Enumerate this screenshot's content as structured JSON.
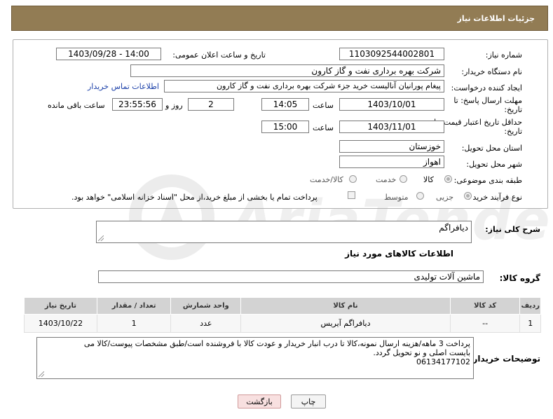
{
  "header": {
    "title": "جزئیات اطلاعات نیاز"
  },
  "form": {
    "need_number_label": "شماره نیاز:",
    "need_number": "1103092544002801",
    "announce_label": "تاریخ و ساعت اعلان عمومی:",
    "announce_value": "1403/09/28 - 14:00",
    "buyer_org_label": "نام دستگاه خریدار:",
    "buyer_org": "شرکت بهره برداری نفت و گاز کارون",
    "creator_label": "ایجاد کننده درخواست:",
    "creator": "پیغام پورانیان آنالیست خرید جزء شرکت بهره برداری نفت و گاز کارون",
    "contact_link": "اطلاعات تماس خریدار",
    "reply_deadline_label": "مهلت ارسال پاسخ: تا تاریخ:",
    "reply_date": "1403/10/01",
    "time_label": "ساعت",
    "reply_time": "14:05",
    "days_value": "2",
    "days_label": "روز و",
    "remaining_time": "23:55:56",
    "remaining_label": "ساعت باقی مانده",
    "price_validity_label": "حداقل تاریخ اعتبار قیمت: تا تاریخ:",
    "price_date": "1403/11/01",
    "price_time": "15:00",
    "province_label": "استان محل تحویل:",
    "province": "خوزستان",
    "city_label": "شهر محل تحویل:",
    "city": "اهواز",
    "category_label": "طبقه بندی موضوعی:",
    "category_options": [
      "کالا",
      "خدمت",
      "کالا/خدمت"
    ],
    "process_label": "نوع فرآیند خرید :",
    "process_options": [
      "جزیی",
      "متوسط"
    ],
    "payment_note": "پرداخت تمام یا بخشی از مبلغ خرید،از محل \"اسناد خزانه اسلامی\" خواهد بود."
  },
  "description": {
    "label": "شرح کلی نیاز:",
    "value": "دیافراگم"
  },
  "goods": {
    "section_title": "اطلاعات کالاهای مورد نیاز",
    "group_label": "گروه کالا:",
    "group_value": "ماشین آلات تولیدی",
    "columns": [
      "ردیف",
      "کد کالا",
      "نام کالا",
      "واحد شمارش",
      "تعداد / مقدار",
      "تاریخ نیاز"
    ],
    "rows": [
      {
        "index": "1",
        "code": "--",
        "name": "دیافراگم آیریس",
        "unit": "عدد",
        "qty": "1",
        "date": "1403/10/22"
      }
    ]
  },
  "buyer_notes": {
    "label": "توضیحات خریدار:",
    "line1": "پرداخت 3 ماهه/هزینه ارسال نمونه،کالا تا درب انبار خریدار و عودت کالا با فروشنده است/طبق مشخصات پیوست/کالا می",
    "line2": "بایست اصلی و نو تحویل گردد.",
    "line3": "06134177102"
  },
  "buttons": {
    "print": "چاپ",
    "back": "بازگشت"
  },
  "colors": {
    "header_bg": "#927c54",
    "link": "#1a3fa8",
    "table_header": "#d3d3d3"
  }
}
